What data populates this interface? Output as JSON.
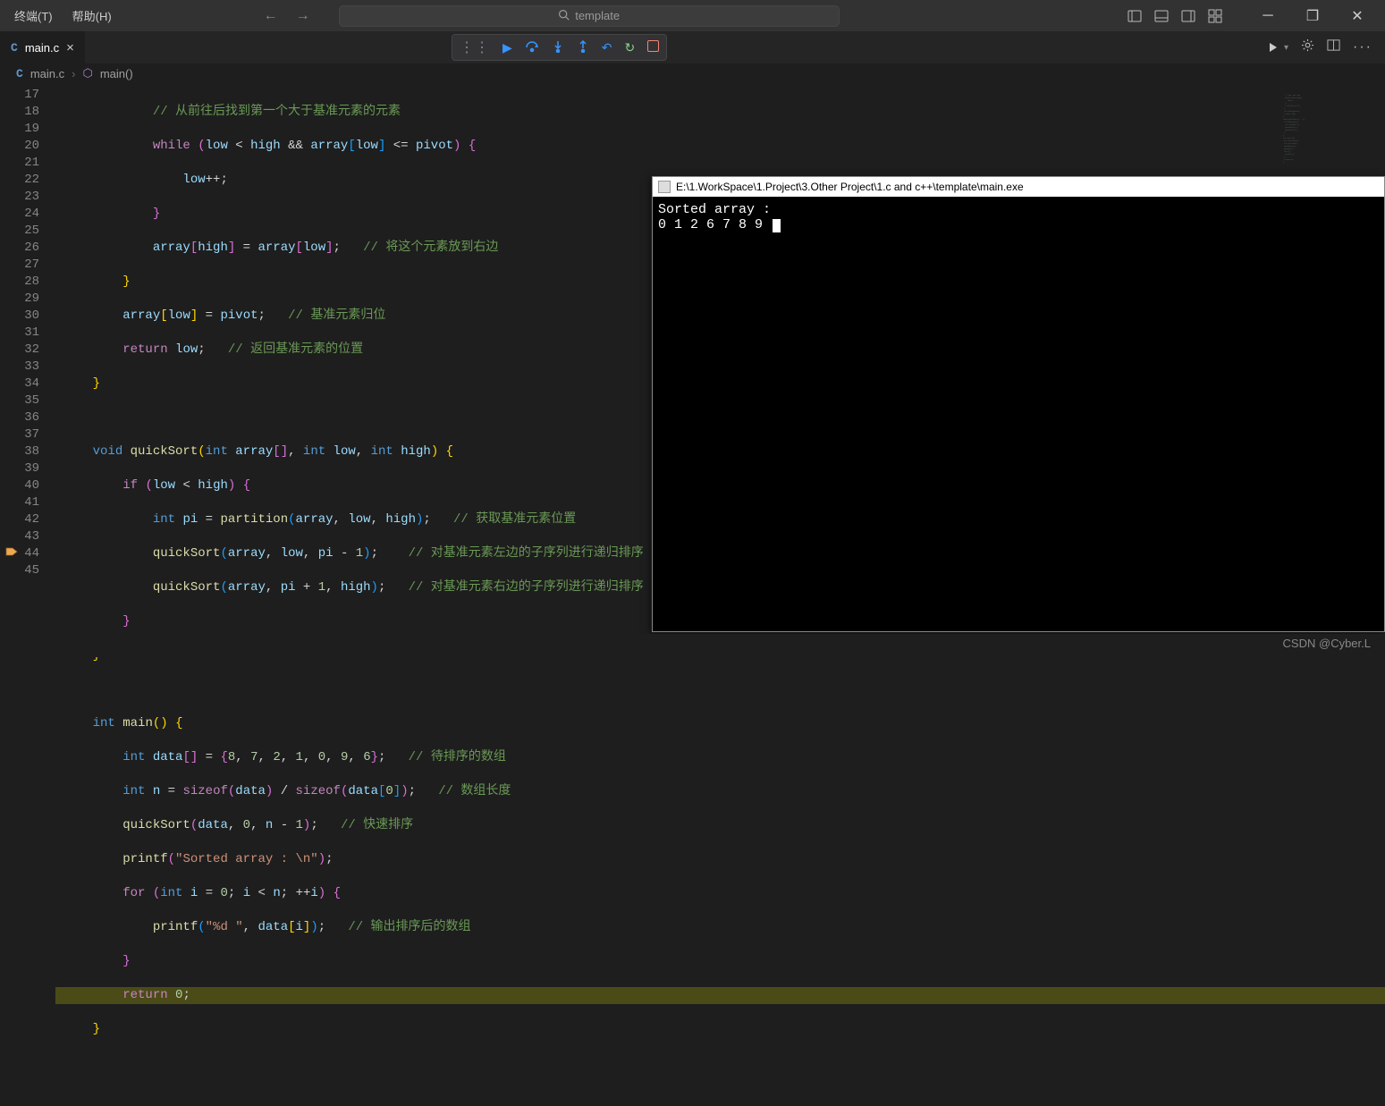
{
  "menu": {
    "terminal": "终端(T)",
    "help": "帮助(H)"
  },
  "search": {
    "placeholder": "template"
  },
  "tab": {
    "filename": "main.c"
  },
  "breadcrumb": {
    "file": "main.c",
    "symbol": "main()"
  },
  "debug_toolbar": {
    "continue": "▶",
    "step_over": "↷",
    "step_into": "↓",
    "step_out": "↑",
    "restart": "↻",
    "stop": "□"
  },
  "line_numbers": [
    17,
    18,
    19,
    20,
    21,
    22,
    23,
    24,
    25,
    26,
    27,
    28,
    29,
    30,
    31,
    32,
    33,
    34,
    35,
    36,
    37,
    38,
    39,
    40,
    41,
    42,
    43,
    44,
    45
  ],
  "code": {
    "l17": {
      "cmt": "// 从前往后找到第一个大于基准元素的元素"
    },
    "l18": {
      "kw": "while",
      "cond": "(low < high && array[low] <= pivot)"
    },
    "l19": {
      "stmt": "low++;"
    },
    "l21": {
      "stmt": "array[high] = array[low];",
      "cmt": "// 将这个元素放到右边"
    },
    "l23": {
      "stmt": "array[low] = pivot;",
      "cmt": "// 基准元素归位"
    },
    "l24": {
      "kw": "return",
      "var": "low",
      "cmt": "// 返回基准元素的位置"
    },
    "l27": {
      "ret": "void",
      "fn": "quickSort",
      "params": "(int array[], int low, int high)"
    },
    "l28": {
      "kw": "if",
      "cond": "(low < high)"
    },
    "l29": {
      "type": "int",
      "var": "pi",
      "fn": "partition",
      "args": "(array, low, high)",
      "cmt": "// 获取基准元素位置"
    },
    "l30": {
      "fn": "quickSort",
      "args": "(array, low, pi - 1)",
      "cmt": "// 对基准元素左边的子序列进行递归排序"
    },
    "l31": {
      "fn": "quickSort",
      "args": "(array, pi + 1, high)",
      "cmt": "// 对基准元素右边的子序列进行递归排序"
    },
    "l35": {
      "type": "int",
      "fn": "main"
    },
    "l36": {
      "type": "int",
      "var": "data",
      "init": "{8, 7, 2, 1, 0, 9, 6}",
      "cmt": "// 待排序的数组"
    },
    "l37": {
      "type": "int",
      "var": "n",
      "expr1": "sizeof",
      "arg1": "(data)",
      "expr2": "sizeof",
      "arg2": "(data[0])",
      "cmt": "// 数组长度"
    },
    "l38": {
      "fn": "quickSort",
      "args": "(data, 0, n - 1)",
      "cmt": "// 快速排序"
    },
    "l39": {
      "fn": "printf",
      "str": "\"Sorted array : \\n\""
    },
    "l40": {
      "kw": "for",
      "init_t": "int",
      "init_v": "i",
      "init_n": "0",
      "cond": "i < n",
      "inc": "++i"
    },
    "l41": {
      "fn": "printf",
      "str": "\"%d \"",
      "arg": "data[i]",
      "cmt": "// 输出排序后的数组"
    },
    "l43": {
      "kw": "return",
      "val": "0"
    }
  },
  "terminal": {
    "title": "E:\\1.WorkSpace\\1.Project\\3.Other Project\\1.c and c++\\template\\main.exe",
    "line1": "Sorted array :",
    "line2": "0 1 2 6 7 8 9"
  },
  "watermark": "CSDN @Cyber.L"
}
